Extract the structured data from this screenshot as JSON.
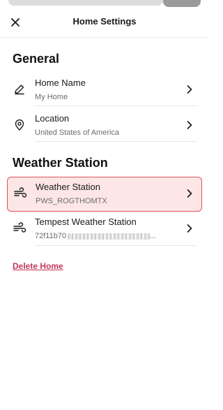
{
  "header": {
    "title": "Home Settings",
    "close_icon": "close-icon"
  },
  "general": {
    "title": "General",
    "items": [
      {
        "label": "Home Name",
        "value": "My Home",
        "icon": "pencil-icon"
      },
      {
        "label": "Location",
        "value": "United States of America",
        "icon": "location-pin-icon"
      }
    ]
  },
  "weather": {
    "title": "Weather Station",
    "items": [
      {
        "label": "Weather Station",
        "value": "PWS_ROGTHOMTX",
        "icon": "wind-icon",
        "highlighted": true
      },
      {
        "label": "Tempest Weather Station",
        "value_prefix": "72f11b70",
        "value_suffix": "...",
        "icon": "wind-icon"
      }
    ]
  },
  "actions": {
    "delete_label": "Delete Home"
  },
  "colors": {
    "accent": "#c0395a",
    "highlight_bg": "#fde6e6",
    "highlight_border": "#e0505a"
  }
}
